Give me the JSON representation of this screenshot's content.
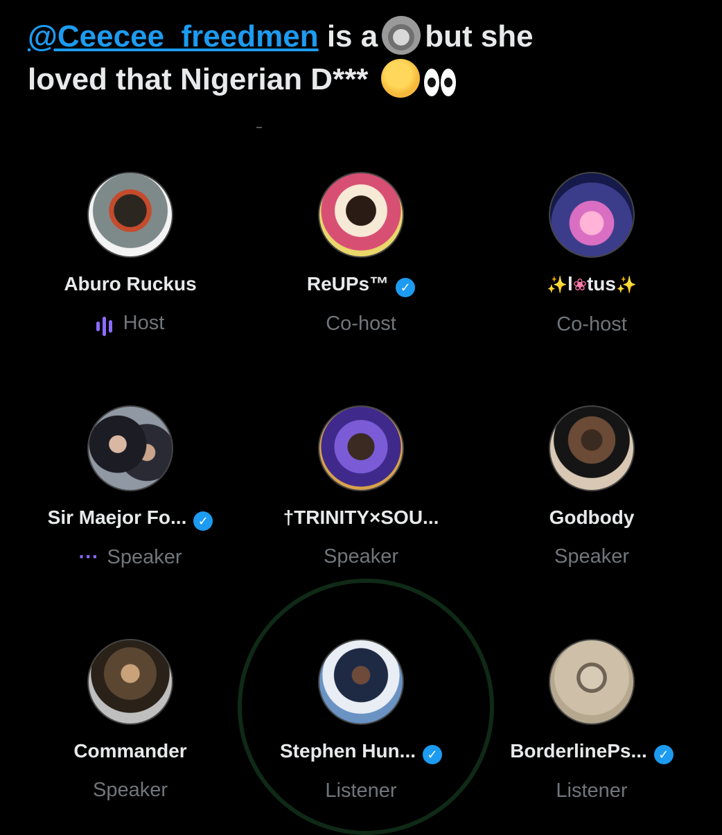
{
  "header": {
    "mention": "@Ceecee_freedmen",
    "text_part1": "is a",
    "text_part2": "but she",
    "text_part3": "loved that Nigerian D***",
    "emoji_1": "raccoon-emoji",
    "emoji_2": "shushing-face-emoji",
    "emoji_3": "eyes-emoji"
  },
  "participants": [
    {
      "name": "Aburo Ruckus",
      "role": "Host",
      "verified": false
    },
    {
      "name": "ReUPs™",
      "role": "Co-host",
      "verified": true
    },
    {
      "name": "l",
      "name_suffix": "tus",
      "role": "Co-host",
      "verified": false
    },
    {
      "name": "Sir Maejor Fo...",
      "role": "Speaker",
      "verified": true
    },
    {
      "name": "†TRINITY×SOU...",
      "role": "Speaker",
      "verified": false
    },
    {
      "name": "Godbody",
      "role": "Speaker",
      "verified": false
    },
    {
      "name": "Commander",
      "role": "Speaker",
      "verified": false
    },
    {
      "name": "Stephen Hun...",
      "role": "Listener",
      "verified": true
    },
    {
      "name": "BorderlinePs...",
      "role": "Listener",
      "verified": true
    }
  ],
  "colors": {
    "background": "#000000",
    "accent_blue": "#1d9bf0",
    "accent_purple": "#8d6bff",
    "muted_text": "#71767b"
  }
}
